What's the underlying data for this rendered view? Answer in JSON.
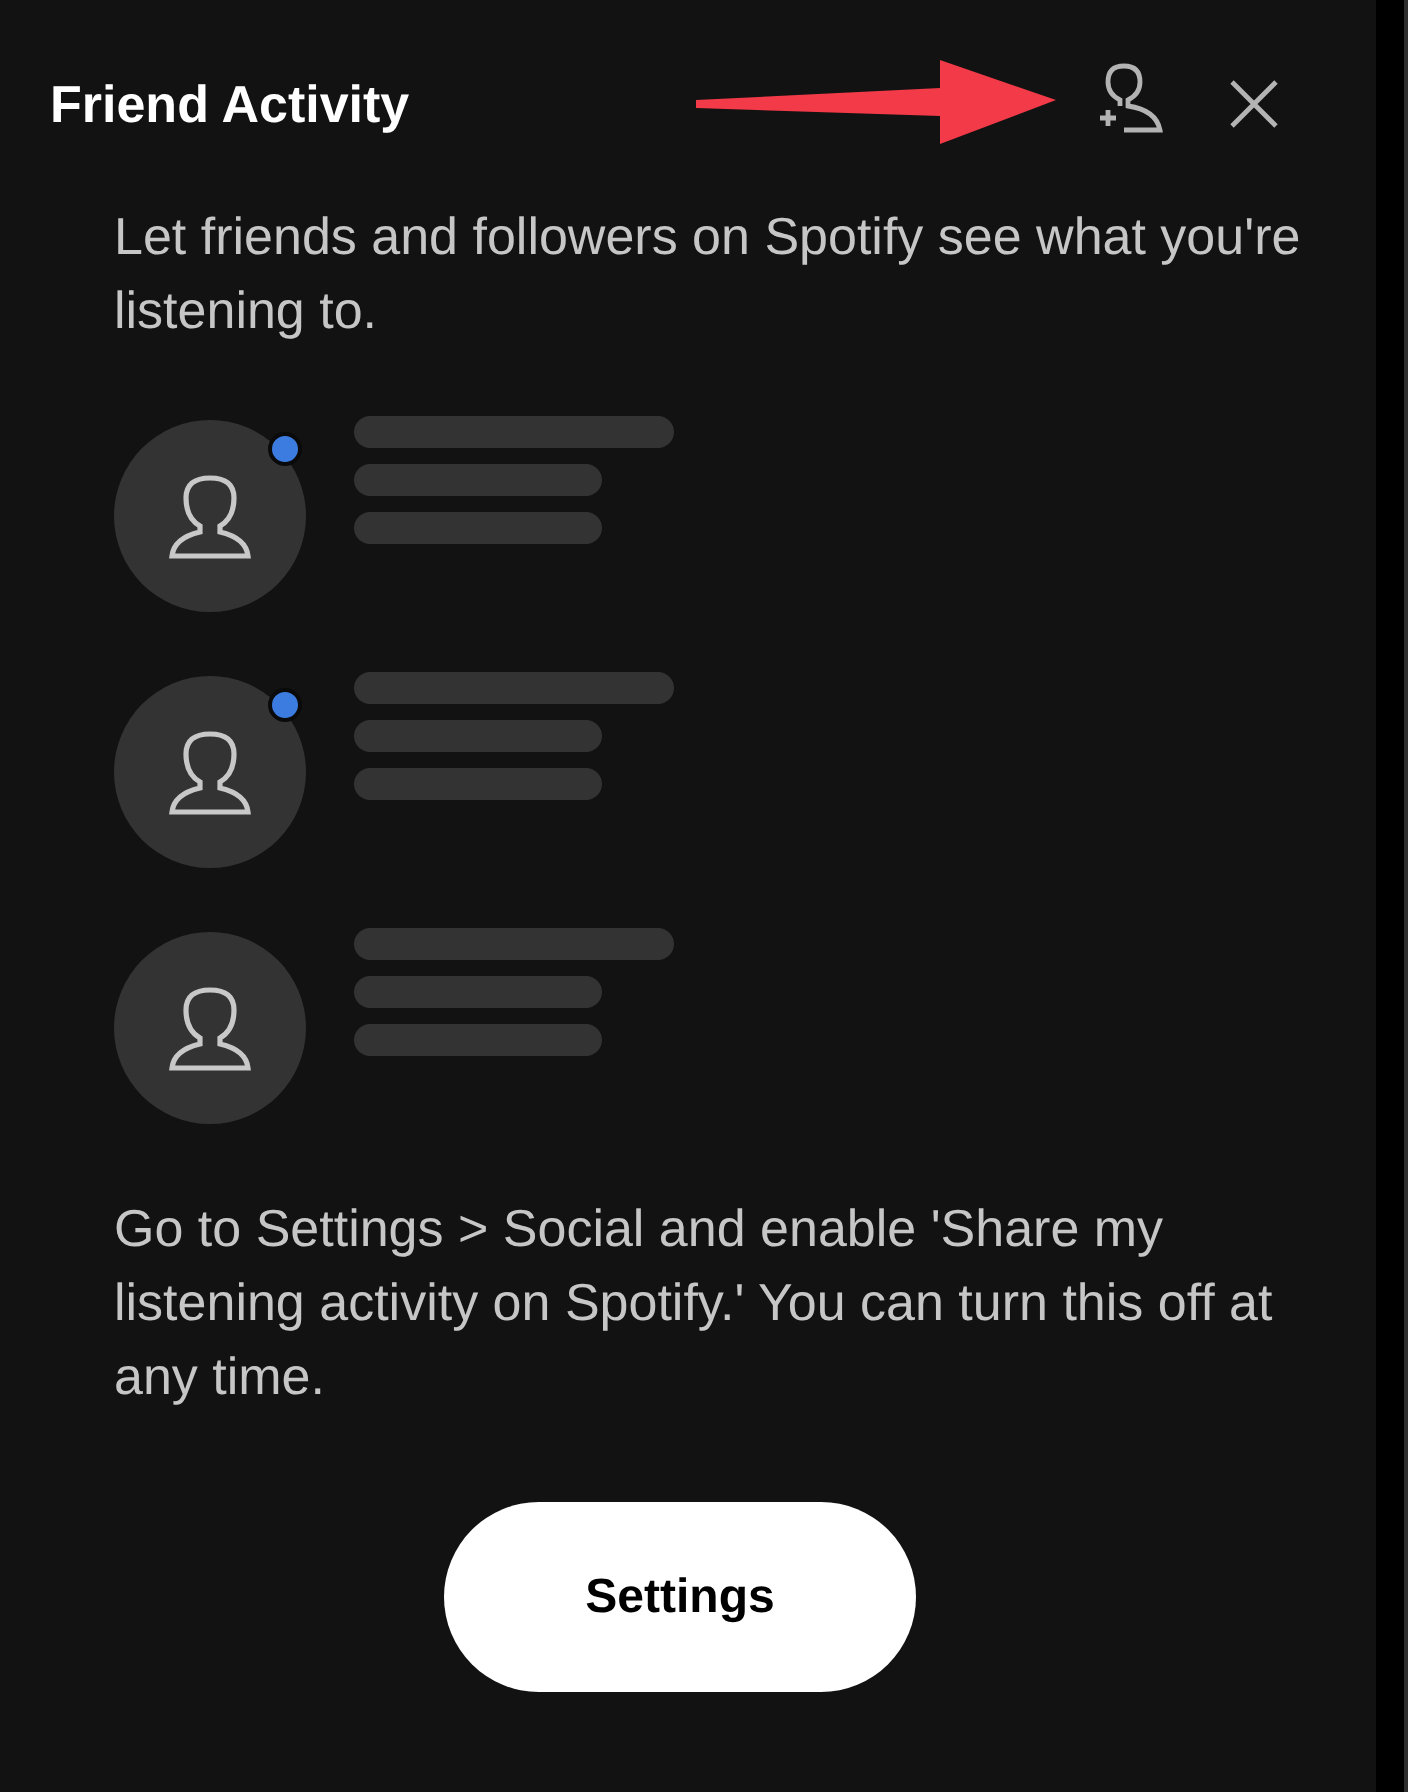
{
  "panel": {
    "title": "Friend Activity",
    "intro": "Let friends and followers on Spotify see what you're listening to.",
    "friends": [
      {
        "online": true
      },
      {
        "online": true
      },
      {
        "online": false
      }
    ],
    "instructions": "Go to Settings > Social and enable 'Share my listening activity on Spotify.' You can turn this off at any time.",
    "button": "Settings"
  },
  "annotation": {
    "kind": "arrow"
  }
}
